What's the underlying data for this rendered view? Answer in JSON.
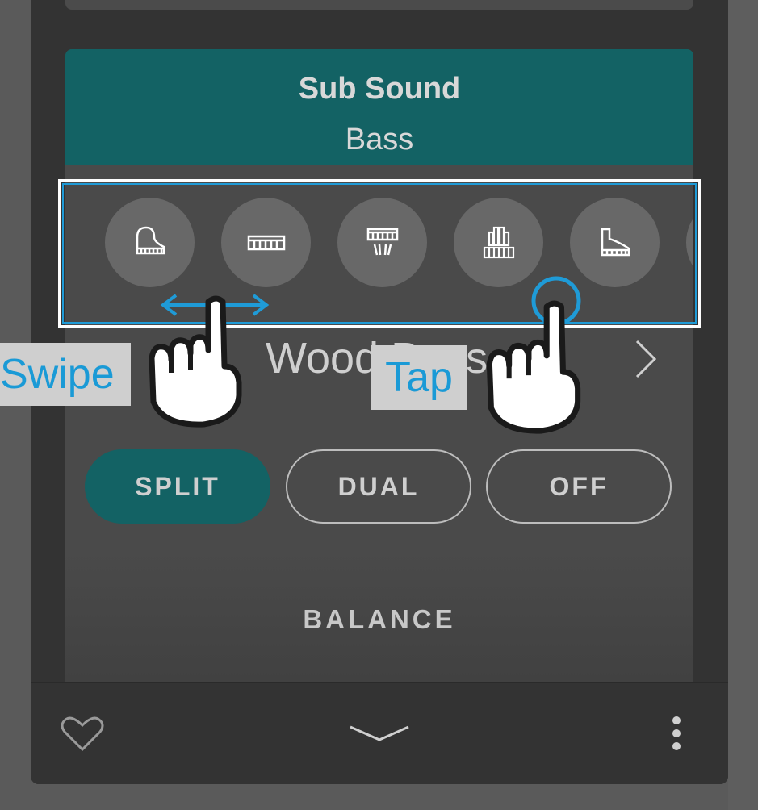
{
  "card": {
    "title": "Sub Sound",
    "subtitle": "Bass"
  },
  "sound_icons": [
    {
      "name": "grand-piano-icon"
    },
    {
      "name": "keyboard-icon"
    },
    {
      "name": "electric-piano-icon"
    },
    {
      "name": "organ-icon"
    },
    {
      "name": "upright-piano-icon"
    },
    {
      "name": "more-sound-icon"
    }
  ],
  "sound_name": "Wood Bass",
  "modes": [
    {
      "label": "SPLIT",
      "active": true
    },
    {
      "label": "DUAL",
      "active": false
    },
    {
      "label": "OFF",
      "active": false
    }
  ],
  "balance_label": "BALANCE",
  "annotations": {
    "swipe": "Swipe",
    "tap": "Tap"
  },
  "colors": {
    "accent": "#136264",
    "highlight": "#1f9bd7",
    "callout_text": "#1a9ad6"
  },
  "bottom_bar": {
    "icons": [
      "heart-icon",
      "chevron-down-icon",
      "more-vertical-icon"
    ]
  }
}
